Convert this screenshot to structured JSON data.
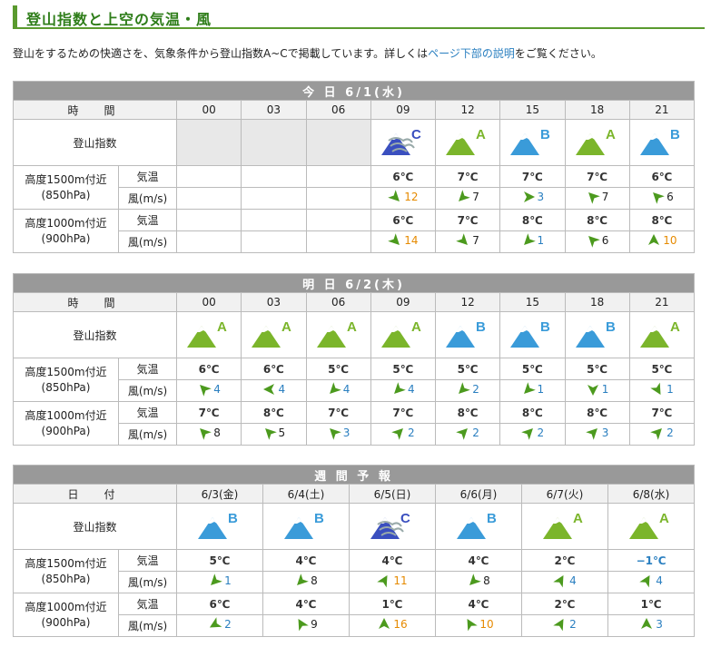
{
  "header": {
    "title": "登山指数と上空の気温・風"
  },
  "intro": {
    "before": "登山をするための快適さを、気象条件から登山指数A~Cで掲載しています。詳しくは",
    "link": "ページ下部の説明",
    "after": "をご覧ください。"
  },
  "labels": {
    "time": "時　間",
    "index": "登山指数",
    "temp": "気温",
    "wind": "風(m/s)",
    "date": "日　付"
  },
  "levels": {
    "l850": {
      "name": "高度1500m付近",
      "hpa": "(850hPa)"
    },
    "l900": {
      "name": "高度1000m付近",
      "hpa": "(900hPa)"
    }
  },
  "colors": {
    "A": "#7bb52b",
    "B": "#3a9bd9",
    "C": "#3a4fbf",
    "accent": "#5a9a2e",
    "link": "#2a7fc0",
    "wind_slow": "#2a7fc0",
    "wind_mid": "#222222",
    "wind_fast": "#e68a00"
  },
  "today": {
    "title": "今 日 6/1(水)",
    "times": [
      "00",
      "03",
      "06",
      "09",
      "12",
      "15",
      "18",
      "21"
    ],
    "index": [
      null,
      null,
      null,
      "C",
      "A",
      "B",
      "A",
      "B"
    ],
    "r850_temp": [
      "",
      "",
      "",
      "6℃",
      "7℃",
      "7℃",
      "7℃",
      "6℃"
    ],
    "r850_wind": [
      null,
      null,
      null,
      {
        "speed": "12",
        "dir": 135,
        "icon": "wind-arrow-icon"
      },
      {
        "speed": "7",
        "dir": 225,
        "icon": "wind-arrow-icon"
      },
      {
        "speed": "3",
        "dir": 90,
        "icon": "wind-arrow-icon"
      },
      {
        "speed": "7",
        "dir": 315,
        "icon": "wind-arrow-icon"
      },
      {
        "speed": "6",
        "dir": 315,
        "icon": "wind-arrow-icon"
      }
    ],
    "r900_temp": [
      "",
      "",
      "",
      "6℃",
      "7℃",
      "8℃",
      "8℃",
      "8℃"
    ],
    "r900_wind": [
      null,
      null,
      null,
      {
        "speed": "14",
        "dir": 135,
        "icon": "wind-arrow-icon"
      },
      {
        "speed": "7",
        "dir": 135,
        "icon": "wind-arrow-icon"
      },
      {
        "speed": "1",
        "dir": 225,
        "icon": "wind-arrow-icon"
      },
      {
        "speed": "6",
        "dir": 315,
        "icon": "wind-arrow-icon"
      },
      {
        "speed": "10",
        "dir": 0,
        "icon": "wind-arrow-icon"
      }
    ]
  },
  "tomorrow": {
    "title": "明 日 6/2(木)",
    "times": [
      "00",
      "03",
      "06",
      "09",
      "12",
      "15",
      "18",
      "21"
    ],
    "index": [
      "A",
      "A",
      "A",
      "A",
      "B",
      "B",
      "B",
      "A"
    ],
    "r850_temp": [
      "6℃",
      "6℃",
      "5℃",
      "5℃",
      "5℃",
      "5℃",
      "5℃",
      "5℃"
    ],
    "r850_wind": [
      {
        "speed": "4",
        "dir": 315,
        "icon": "wind-arrow-icon"
      },
      {
        "speed": "4",
        "dir": 270,
        "icon": "wind-arrow-icon"
      },
      {
        "speed": "4",
        "dir": 225,
        "icon": "wind-arrow-icon"
      },
      {
        "speed": "4",
        "dir": 225,
        "icon": "wind-arrow-icon"
      },
      {
        "speed": "2",
        "dir": 225,
        "icon": "wind-arrow-icon"
      },
      {
        "speed": "1",
        "dir": 225,
        "icon": "wind-arrow-icon"
      },
      {
        "speed": "1",
        "dir": 180,
        "icon": "wind-arrow-icon"
      },
      {
        "speed": "1",
        "dir": 150,
        "icon": "wind-arrow-icon"
      }
    ],
    "r900_temp": [
      "7℃",
      "8℃",
      "7℃",
      "7℃",
      "8℃",
      "8℃",
      "8℃",
      "7℃"
    ],
    "r900_wind": [
      {
        "speed": "8",
        "dir": 315,
        "icon": "wind-arrow-icon"
      },
      {
        "speed": "5",
        "dir": 315,
        "icon": "wind-arrow-icon"
      },
      {
        "speed": "3",
        "dir": 315,
        "icon": "wind-arrow-icon"
      },
      {
        "speed": "2",
        "dir": 45,
        "icon": "wind-arrow-icon"
      },
      {
        "speed": "2",
        "dir": 45,
        "icon": "wind-arrow-icon"
      },
      {
        "speed": "2",
        "dir": 45,
        "icon": "wind-arrow-icon"
      },
      {
        "speed": "3",
        "dir": 45,
        "icon": "wind-arrow-icon"
      },
      {
        "speed": "2",
        "dir": 45,
        "icon": "wind-arrow-icon"
      }
    ]
  },
  "weekly": {
    "title": "週 間 予 報",
    "dates": [
      "6/3(金)",
      "6/4(土)",
      "6/5(日)",
      "6/6(月)",
      "6/7(火)",
      "6/8(水)"
    ],
    "index": [
      "B",
      "B",
      "C",
      "B",
      "A",
      "A"
    ],
    "r850_temp": [
      "5℃",
      "4℃",
      "4℃",
      "4℃",
      "2℃",
      "−1℃"
    ],
    "r850_wind": [
      {
        "speed": "1",
        "dir": 225,
        "icon": "wind-arrow-icon"
      },
      {
        "speed": "8",
        "dir": 225,
        "icon": "wind-arrow-icon"
      },
      {
        "speed": "11",
        "dir": 30,
        "icon": "wind-arrow-icon"
      },
      {
        "speed": "8",
        "dir": 225,
        "icon": "wind-arrow-icon"
      },
      {
        "speed": "4",
        "dir": 30,
        "icon": "wind-arrow-icon"
      },
      {
        "speed": "4",
        "dir": 30,
        "icon": "wind-arrow-icon"
      }
    ],
    "r900_temp": [
      "6℃",
      "4℃",
      "1℃",
      "4℃",
      "2℃",
      "1℃"
    ],
    "r900_wind": [
      {
        "speed": "2",
        "dir": 240,
        "icon": "wind-arrow-icon"
      },
      {
        "speed": "9",
        "dir": 330,
        "icon": "wind-arrow-icon"
      },
      {
        "speed": "16",
        "dir": 0,
        "icon": "wind-arrow-icon"
      },
      {
        "speed": "10",
        "dir": 330,
        "icon": "wind-arrow-icon"
      },
      {
        "speed": "2",
        "dir": 30,
        "icon": "wind-arrow-icon"
      },
      {
        "speed": "3",
        "dir": 0,
        "icon": "wind-arrow-icon"
      }
    ]
  }
}
